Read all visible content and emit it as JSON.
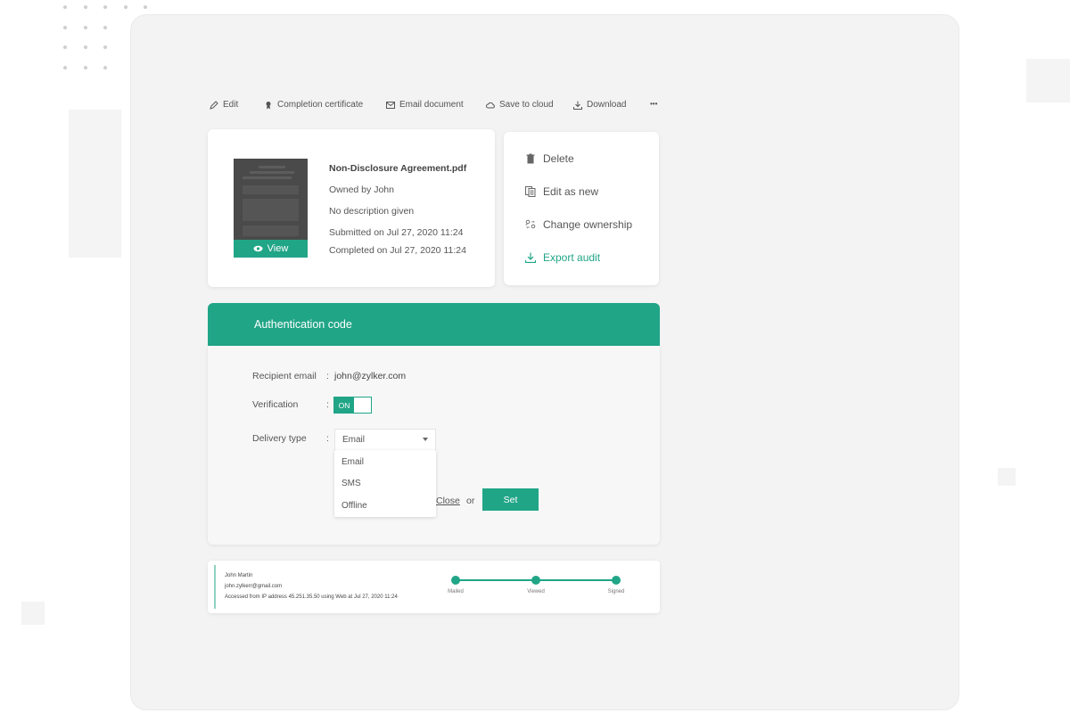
{
  "toolbar": {
    "items": [
      {
        "label": "Edit",
        "icon": "pencil-icon"
      },
      {
        "label": "Completion certificate",
        "icon": "certificate-icon"
      },
      {
        "label": "Email document",
        "icon": "envelope-icon"
      },
      {
        "label": "Save to cloud",
        "icon": "cloud-icon"
      },
      {
        "label": "Download",
        "icon": "download-icon"
      }
    ],
    "more_label": "•••"
  },
  "document": {
    "title": "Non-Disclosure Agreement.pdf",
    "owner": "Owned by John",
    "description": "No description given",
    "submitted": "Submitted on Jul 27, 2020 11:24",
    "completed": "Completed on Jul 27, 2020 11:24",
    "view_label": "View"
  },
  "actions": [
    {
      "label": "Delete",
      "icon": "trash-icon"
    },
    {
      "label": "Edit as new",
      "icon": "copy-icon"
    },
    {
      "label": "Change ownership",
      "icon": "change-owner-icon"
    },
    {
      "label": "Export audit",
      "icon": "download-icon"
    }
  ],
  "auth": {
    "header": "Authentication code",
    "recipient_label": "Recipient email",
    "recipient_value": "john@zylker.com",
    "verification_label": "Verification",
    "verification_state": "ON",
    "delivery_label": "Delivery type",
    "delivery_selected": "Email",
    "delivery_options": [
      "Email",
      "SMS",
      "Offline"
    ],
    "colon": ":",
    "close_label": "Close",
    "or_label": "or",
    "set_label": "Set"
  },
  "activity": {
    "name": "John Martin",
    "email": "john.zylkerr@gmail.com",
    "access": "Accessed from IP address 45.251.35.50 using Web at Jul 27, 2020 11:24",
    "steps": [
      "Mailed",
      "Viewed",
      "Signed"
    ]
  },
  "colors": {
    "accent": "#21a587",
    "panel": "#f3f3f3"
  }
}
